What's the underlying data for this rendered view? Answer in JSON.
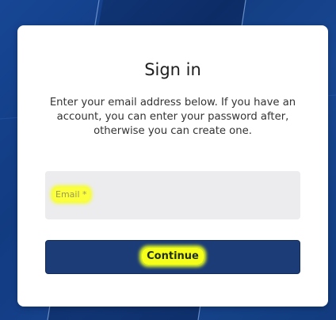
{
  "signin": {
    "title": "Sign in",
    "description": "Enter your email address below. If you have an account, you can enter your password after, otherwise you can create one.",
    "email_placeholder": "Email *",
    "continue_label": "Continue"
  },
  "colors": {
    "background": "#0d3a7a",
    "button": "#1c3c78",
    "highlight": "#f6ff1a",
    "field": "#ececee"
  }
}
